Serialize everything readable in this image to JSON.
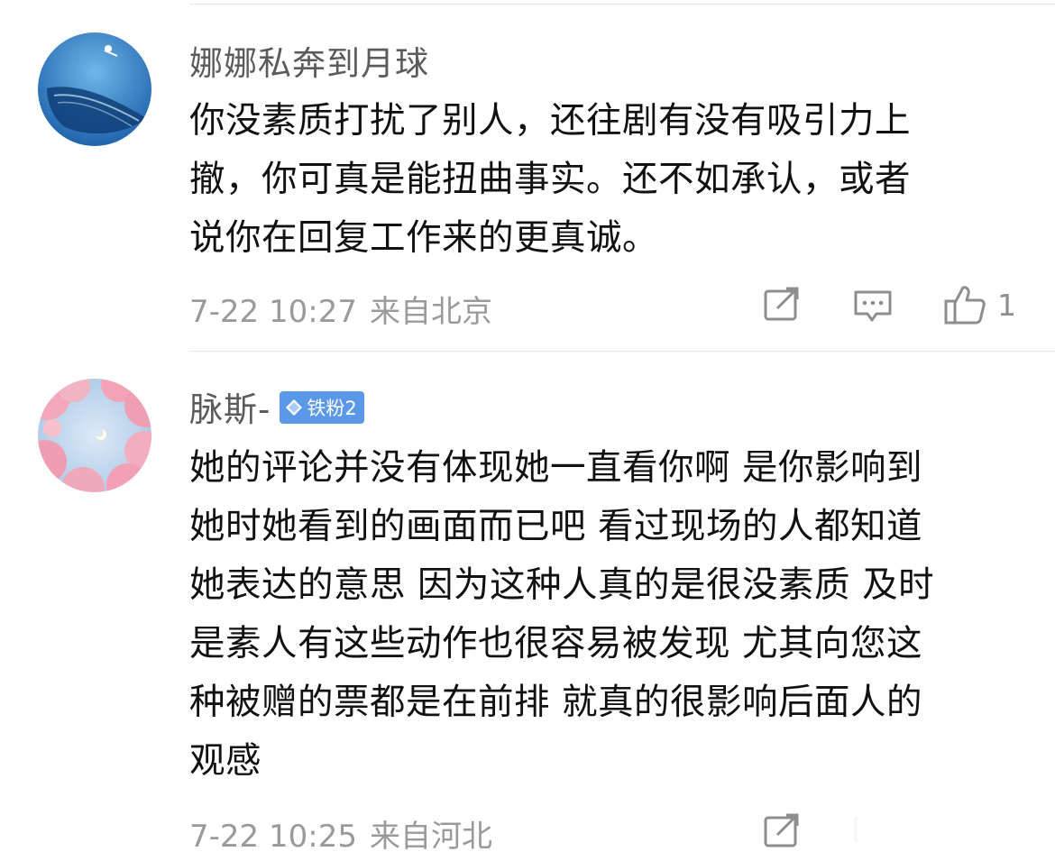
{
  "comments": [
    {
      "username": "娜娜私奔到月球",
      "badge": "",
      "lines": [
        "你没素质打扰了别人，还往剧有没有吸引力上",
        "撤，你可真是能扭曲事实。还不如承认，或者",
        "说你在回复工作来的更真诚。"
      ],
      "time": "7-22 10:27",
      "location": "来自北京",
      "like_count": "1",
      "icons": [
        "repost-icon",
        "comment-icon",
        "like-icon"
      ]
    },
    {
      "username": "脉斯-",
      "badge": "铁粉2",
      "lines": [
        "她的评论并没有体现她一直看你啊 是你影响到",
        "她时她看到的画面而已吧 看过现场的人都知道",
        "她表达的意思 因为这种人真的是很没素质 及时",
        "是素人有这些动作也很容易被发现 尤其向您这",
        "种被赠的票都是在前排 就真的很影响后面人的",
        "观感"
      ],
      "time": "7-22 10:25",
      "location": "来自河北",
      "like_count": "",
      "icons": [
        "repost-icon",
        "comment-icon",
        "like-icon"
      ]
    }
  ],
  "colors": {
    "badge": "#5b98e8",
    "meta": "#9a9a9a",
    "username": "#5b5b5b"
  }
}
